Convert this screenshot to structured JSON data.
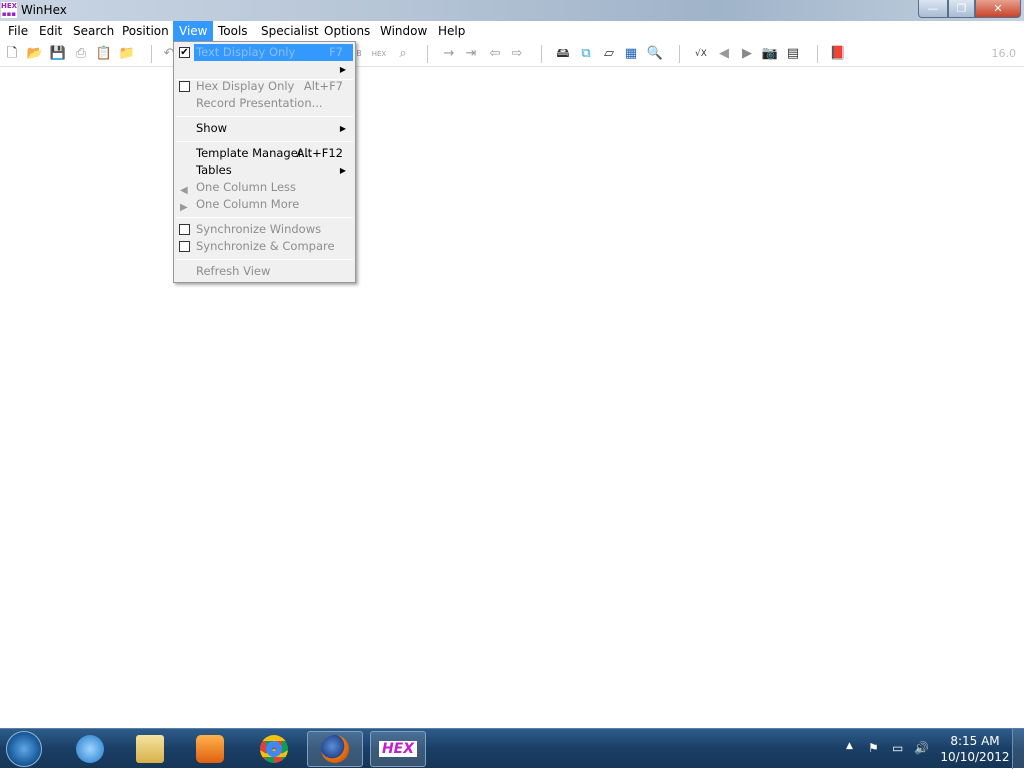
{
  "window": {
    "title": "WinHex",
    "logo_text": "HEX",
    "min": "—",
    "restore": "❐",
    "close": "✕"
  },
  "menubar": [
    "File",
    "Edit",
    "Search",
    "Position",
    "View",
    "Tools",
    "Specialist",
    "Options",
    "Window",
    "Help"
  ],
  "active_menu": "View",
  "toolbar": {
    "version": "16.0"
  },
  "view_menu": {
    "text_display_only": {
      "label": "Text Display Only",
      "shortcut": "F7",
      "checked": true
    },
    "hex_display_only": {
      "label": "Hex Display Only",
      "shortcut": "Alt+F7",
      "checked": false
    },
    "record_presentation": {
      "label": "Record Presentation..."
    },
    "show": {
      "label": "Show"
    },
    "template_manager": {
      "label": "Template Manager...",
      "shortcut": "Alt+F12"
    },
    "tables": {
      "label": "Tables"
    },
    "one_column_less": {
      "label": "One Column Less"
    },
    "one_column_more": {
      "label": "One Column More"
    },
    "sync_windows": {
      "label": "Synchronize Windows",
      "checked": false
    },
    "sync_compare": {
      "label": "Synchronize & Compare",
      "checked": false
    },
    "refresh_view": {
      "label": "Refresh View"
    }
  },
  "taskbar": {
    "apps": [
      "internet-explorer",
      "windows-explorer",
      "media-player",
      "chrome",
      "firefox",
      "winhex"
    ],
    "winhex_label": "HEX",
    "time": "8:15 AM",
    "date": "10/10/2012"
  }
}
